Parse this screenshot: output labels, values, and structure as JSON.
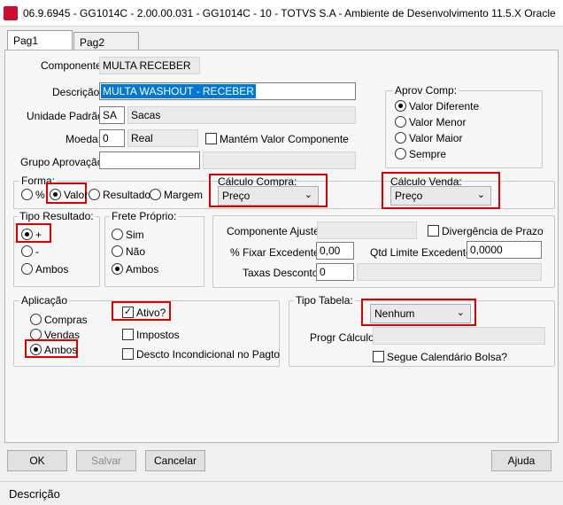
{
  "window": {
    "title": "06.9.6945 - GG1014C - 2.00.00.031 - GG1014C - 10 - TOTVS S.A - Ambiente de Desenvolvimento 11.5.X Oracle"
  },
  "tabs": [
    {
      "label": "Pag1"
    },
    {
      "label": "Pag2"
    }
  ],
  "form": {
    "componente": {
      "label": "Componente:",
      "value": "MULTA RECEBER"
    },
    "descricao": {
      "label": "Descrição:",
      "value": "MULTA WASHOUT - RECEBER"
    },
    "unidade": {
      "label": "Unidade Padrão:",
      "code": "SA",
      "desc": "Sacas"
    },
    "moeda": {
      "label": "Moeda:",
      "code": "0",
      "desc": "Real"
    },
    "mantem_valor": {
      "label": "Mantém Valor Componente"
    },
    "grupo_aprovacao": {
      "label": "Grupo Aprovação:",
      "value": "",
      "desc": ""
    }
  },
  "aprov_comp": {
    "title": "Aprov Comp:",
    "options": [
      {
        "label": "Valor Diferente",
        "selected": true
      },
      {
        "label": "Valor Menor",
        "selected": false
      },
      {
        "label": "Valor Maior",
        "selected": false
      },
      {
        "label": "Sempre",
        "selected": false
      }
    ]
  },
  "forma": {
    "title": "Forma:",
    "options": [
      {
        "label": "%"
      },
      {
        "label": "Valor"
      },
      {
        "label": "Resultado"
      },
      {
        "label": "Margem"
      }
    ]
  },
  "calculo_compra": {
    "title": "Cálculo Compra:",
    "value": "Preço"
  },
  "calculo_venda": {
    "title": "Cálculo Venda:",
    "value": "Preço"
  },
  "tipo_resultado": {
    "title": "Tipo Resultado:",
    "options": [
      {
        "label": "+"
      },
      {
        "label": "-"
      },
      {
        "label": "Ambos"
      }
    ]
  },
  "frete_proprio": {
    "title": "Frete Próprio:",
    "options": [
      {
        "label": "Sim"
      },
      {
        "label": "Não"
      },
      {
        "label": "Ambos"
      }
    ]
  },
  "ajuste": {
    "componente_ajuste": {
      "label": "Componente Ajuste:",
      "value": ""
    },
    "divergencia": {
      "label": "Divergência de Prazo"
    },
    "fixar_excedente": {
      "label": "% Fixar Excedente:",
      "value": "0,00"
    },
    "qtd_limite": {
      "label": "Qtd Limite Excedente:",
      "value": "0,0000"
    },
    "taxas_desconto": {
      "label": "Taxas Desconto:",
      "value": "0"
    }
  },
  "aplicacao": {
    "title": "Aplicação",
    "options": [
      {
        "label": "Compras"
      },
      {
        "label": "Vendas"
      },
      {
        "label": "Ambos"
      }
    ],
    "ativo": {
      "label": "Ativo?",
      "mark": "✓"
    },
    "impostos": {
      "label": "Impostos"
    },
    "descto": {
      "label": "Descto Incondicional no Pagto"
    }
  },
  "tipo_tabela": {
    "title": "Tipo Tabela:",
    "value": "Nenhum",
    "progr_calculo": {
      "label": "Progr Cálculo:",
      "value": ""
    },
    "segue_calendario": {
      "label": "Segue Calendário Bolsa?"
    }
  },
  "buttons": {
    "ok": "OK",
    "salvar": "Salvar",
    "cancelar": "Cancelar",
    "ajuda": "Ajuda"
  },
  "status": {
    "text": "Descrição"
  },
  "colors": {
    "highlight_red": "#e00000",
    "selection_blue": "#0078d7"
  }
}
